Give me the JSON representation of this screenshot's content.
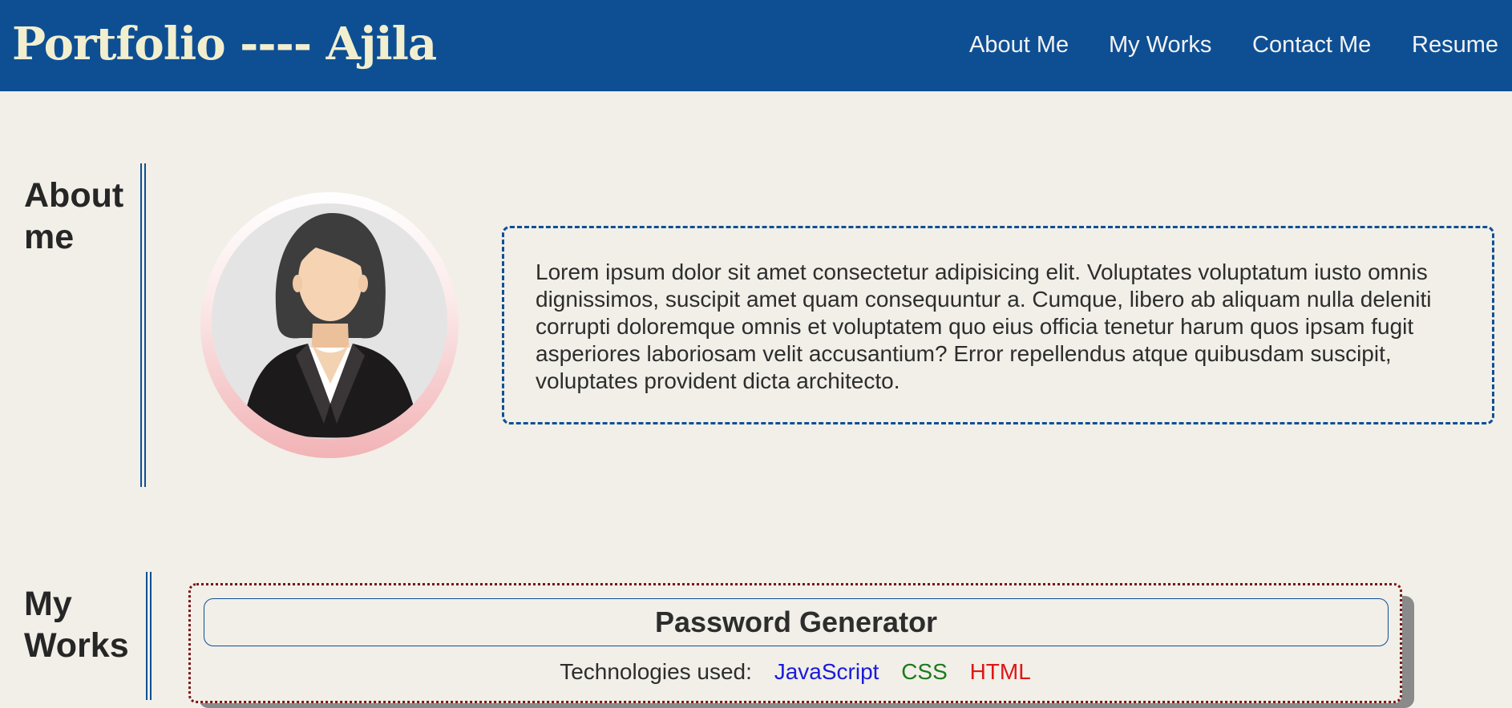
{
  "header": {
    "brand": "Portfolio ---- Ajila",
    "nav": [
      "About Me",
      "My Works",
      "Contact Me",
      "Resume"
    ]
  },
  "about": {
    "title_line1": "About",
    "title_line2": "me",
    "text": "Lorem ipsum dolor sit amet consectetur adipisicing elit. Voluptates voluptatum iusto omnis dignissimos, suscipit amet quam consequuntur a. Cumque, libero ab aliquam nulla deleniti corrupti doloremque omnis et voluptatem quo eius officia tenetur harum quos ipsam fugit asperiores laboriosam velit accusantium? Error repellendus atque quibusdam suscipit, voluptates provident dicta architecto."
  },
  "works": {
    "title_line1": "My",
    "title_line2": "Works",
    "project_title": "Password Generator",
    "tech_label": "Technologies used:",
    "techs": [
      {
        "name": "JavaScript",
        "color": "#1a1adb"
      },
      {
        "name": "CSS",
        "color": "#1d7a1d"
      },
      {
        "name": "HTML",
        "color": "#e01515"
      }
    ]
  },
  "colors": {
    "header_bg": "#0e4f94",
    "brand": "#f2efcf",
    "page_bg": "#f1efe8"
  }
}
